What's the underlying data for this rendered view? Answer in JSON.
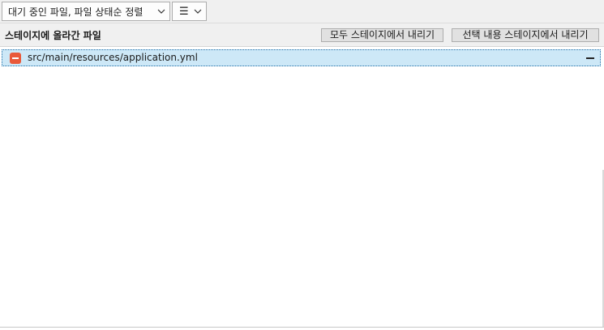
{
  "toolbar": {
    "sort_dropdown": {
      "label": "대기 중인 파일, 파일 상태순 정렬",
      "icon": "chevron-down-icon"
    },
    "view_dropdown": {
      "glyph": "☰",
      "icon": "list-view-icon"
    }
  },
  "staged_section": {
    "title": "스테이지에 올라간 파일",
    "unstage_all_label": "모두 스테이지에서 내리기",
    "unstage_selected_label": "선택 내용 스테이지에서 내리기"
  },
  "files": [
    {
      "path": "src/main/resources/application.yml",
      "status": "removed",
      "status_color": "#e9593a",
      "selected": true
    }
  ],
  "colors": {
    "selection": "#cde8f7",
    "selection_border": "#1e6fa8",
    "toolbar_bg": "#f0f0f0",
    "removed_status": "#e9593a"
  }
}
